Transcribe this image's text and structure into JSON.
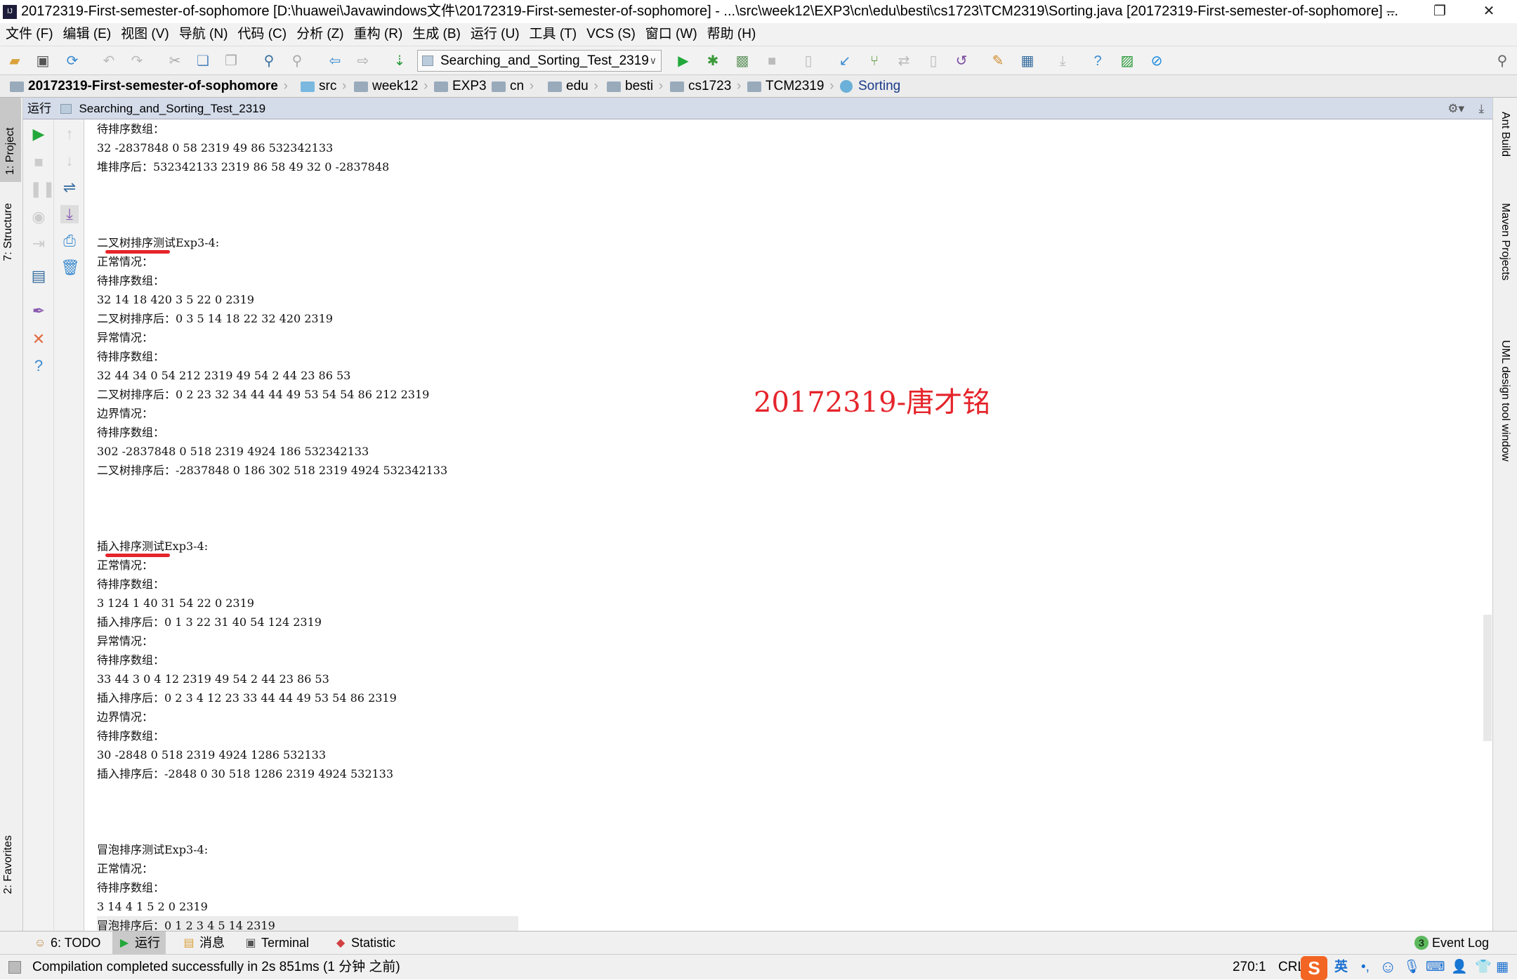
{
  "window": {
    "title": "20172319-First-semester-of-sophomore [D:\\huawei\\Javawindows文件\\20172319-First-semester-of-sophomore] - ...\\src\\week12\\EXP3\\cn\\edu\\besti\\cs1723\\TCM2319\\Sorting.java [20172319-First-semester-of-sophomore] ..."
  },
  "menu": [
    "文件 (F)",
    "编辑 (E)",
    "视图 (V)",
    "导航 (N)",
    "代码 (C)",
    "分析 (Z)",
    "重构 (R)",
    "生成 (B)",
    "运行 (U)",
    "工具 (T)",
    "VCS (S)",
    "窗口 (W)",
    "帮助 (H)"
  ],
  "toolbar": {
    "run_config": "Searching_and_Sorting_Test_2319"
  },
  "breadcrumb": [
    "20172319-First-semester-of-sophomore",
    "src",
    "week12",
    "EXP3",
    "cn",
    "edu",
    "besti",
    "cs1723",
    "TCM2319",
    "Sorting"
  ],
  "run_panel": {
    "label": "运行",
    "config": "Searching_and_Sorting_Test_2319"
  },
  "left_tabs": [
    "1: Project",
    "7: Structure",
    "2: Favorites"
  ],
  "right_tabs": [
    "Ant Build",
    "Maven Projects",
    "UML design tool window"
  ],
  "console": {
    "lines": [
      {
        "text": "待排序数组："
      },
      {
        "text": "32 -2837848 0 58 2319 49 86 532342133"
      },
      {
        "text": "堆排序后：532342133 2319 86 58 49 32 0 -2837848"
      },
      {
        "text": ""
      },
      {
        "text": ""
      },
      {
        "text": ""
      },
      {
        "text": "二叉树排序测试Exp3-4:",
        "marked": true
      },
      {
        "text": "正常情况："
      },
      {
        "text": "待排序数组："
      },
      {
        "text": "32 14 18 420 3 5 22 0 2319"
      },
      {
        "text": "二叉树排序后：0 3 5 14 18 22 32 420 2319"
      },
      {
        "text": "异常情况："
      },
      {
        "text": "待排序数组："
      },
      {
        "text": "32 44 34 0 54 212 2319 49 54 2 44 23 86 53"
      },
      {
        "text": "二叉树排序后：0 2 23 32 34 44 44 49 53 54 54 86 212 2319"
      },
      {
        "text": "边界情况："
      },
      {
        "text": "待排序数组："
      },
      {
        "text": "302 -2837848 0 518 2319 4924 186 532342133"
      },
      {
        "text": "二叉树排序后：-2837848 0 186 302 518 2319 4924 532342133"
      },
      {
        "text": ""
      },
      {
        "text": ""
      },
      {
        "text": ""
      },
      {
        "text": "插入排序测试Exp3-4:",
        "marked": true
      },
      {
        "text": "正常情况："
      },
      {
        "text": "待排序数组："
      },
      {
        "text": "3 124 1 40 31 54 22 0 2319"
      },
      {
        "text": "插入排序后：0 1 3 22 31 40 54 124 2319"
      },
      {
        "text": "异常情况："
      },
      {
        "text": "待排序数组："
      },
      {
        "text": "33 44 3 0 4 12 2319 49 54 2 44 23 86 53"
      },
      {
        "text": "插入排序后：0 2 3 4 12 23 33 44 44 49 53 54 86 2319"
      },
      {
        "text": "边界情况："
      },
      {
        "text": "待排序数组："
      },
      {
        "text": "30 -2848 0 518 2319 4924 1286 532133"
      },
      {
        "text": "插入排序后：-2848 0 30 518 1286 2319 4924 532133"
      },
      {
        "text": ""
      },
      {
        "text": ""
      },
      {
        "text": ""
      },
      {
        "text": "冒泡排序测试Exp3-4:"
      },
      {
        "text": "正常情况："
      },
      {
        "text": "待排序数组："
      },
      {
        "text": "3 14 4 1 5 2 0 2319"
      },
      {
        "text": "冒泡排序后：0 1 2 3 4 5 14 2319",
        "current": true
      }
    ],
    "watermark": "20172319-唐才铭",
    "annotation_color": "#e5242b"
  },
  "bottom_tabs": [
    {
      "label": "6: TODO",
      "icon": "todo-icon"
    },
    {
      "label": "运行",
      "icon": "run-icon",
      "active": true
    },
    {
      "label": "消息",
      "icon": "messages-icon"
    },
    {
      "label": "Terminal",
      "icon": "terminal-icon"
    },
    {
      "label": "Statistic",
      "icon": "statistic-icon"
    }
  ],
  "event_log": {
    "count": "3",
    "label": "Event Log"
  },
  "status": {
    "message": "Compilation completed successfully in 2s 851ms (1 分钟 之前)",
    "position": "270:1",
    "line_sep": "CRL",
    "ime_lang": "英"
  }
}
